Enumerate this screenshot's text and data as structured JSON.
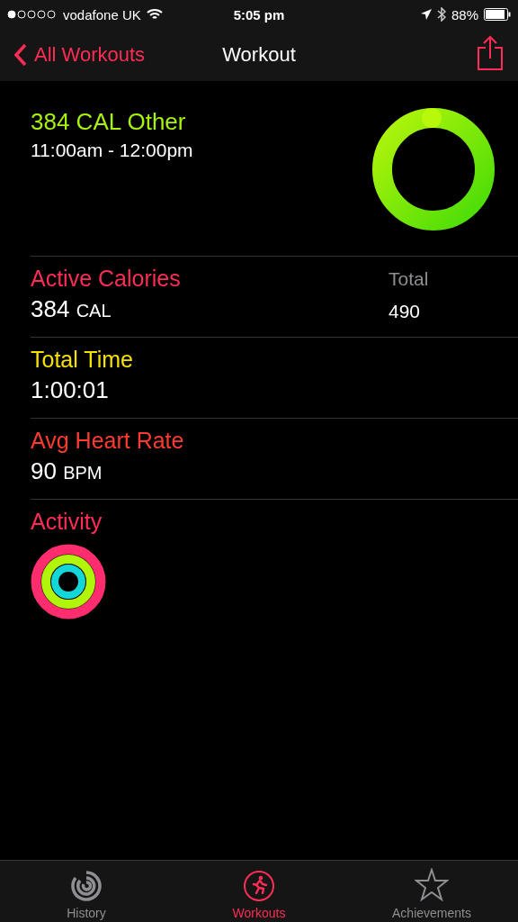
{
  "status_bar": {
    "carrier": "vodafone UK",
    "time": "5:05 pm",
    "battery": "88%"
  },
  "nav": {
    "back": "All Workouts",
    "title": "Workout"
  },
  "summary": {
    "title": "384 CAL Other",
    "time_range": "11:00am - 12:00pm"
  },
  "metrics": [
    {
      "label": "Active Calories",
      "color": "#ff2d55",
      "value": "384",
      "unit": "CAL",
      "extra_label": "Total",
      "extra_value": "490"
    },
    {
      "label": "Total Time",
      "color": "#f5e100",
      "value": "1:00:01"
    },
    {
      "label": "Avg Heart Rate",
      "color": "#ff3b30",
      "value": "90",
      "unit": "BPM"
    }
  ],
  "activity": {
    "label": "Activity"
  },
  "tabs": [
    {
      "label": "History",
      "selected": false
    },
    {
      "label": "Workouts",
      "selected": true
    },
    {
      "label": "Achievements",
      "selected": false
    }
  ]
}
